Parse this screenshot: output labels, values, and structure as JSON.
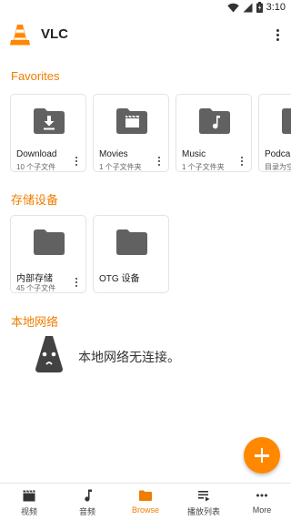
{
  "status": {
    "time": "3:10"
  },
  "app": {
    "title": "VLC"
  },
  "favorites": {
    "title": "Favorites",
    "items": [
      {
        "name": "Download",
        "sub": "10 个子文件",
        "icon": "download-folder-icon"
      },
      {
        "name": "Movies",
        "sub": "1 个子文件夹",
        "icon": "movies-folder-icon"
      },
      {
        "name": "Music",
        "sub": "1 个子文件夹",
        "icon": "music-folder-icon"
      },
      {
        "name": "Podca",
        "sub": "目录为空",
        "icon": "folder-icon"
      }
    ]
  },
  "storage": {
    "title": "存储设备",
    "items": [
      {
        "name": "内部存储",
        "sub": "45 个子文件"
      },
      {
        "name": "OTG 设备",
        "sub": ""
      }
    ]
  },
  "network": {
    "title": "本地网络",
    "empty_text": "本地网络无连接。"
  },
  "nav": [
    {
      "label": "视频",
      "icon": "video-icon"
    },
    {
      "label": "音频",
      "icon": "music-note-icon"
    },
    {
      "label": "Browse",
      "icon": "folder-icon",
      "active": true
    },
    {
      "label": "播放列表",
      "icon": "playlist-icon"
    },
    {
      "label": "More",
      "icon": "more-icon"
    }
  ],
  "colors": {
    "accent": "#ef7d00",
    "fab": "#ff8800",
    "folder": "#616161"
  }
}
